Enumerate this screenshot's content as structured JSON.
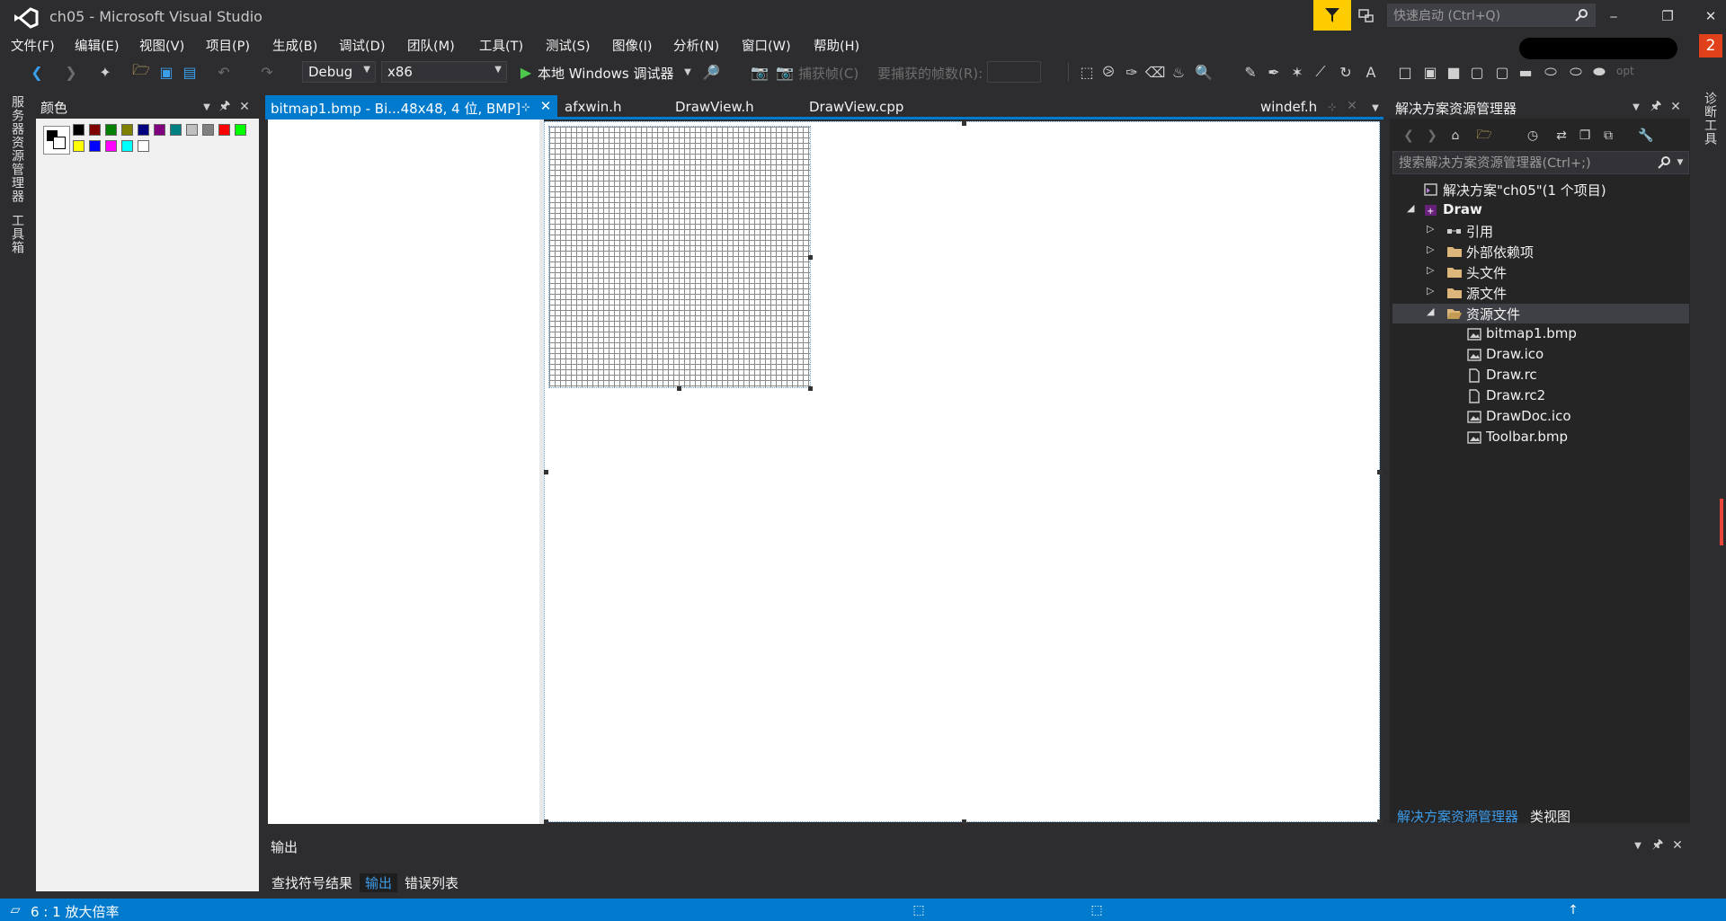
{
  "title_bar": {
    "title": "ch05 - Microsoft Visual Studio",
    "quick_launch_placeholder": "快速启动 (Ctrl+Q)",
    "notification_count": "2"
  },
  "menu": [
    "文件(F)",
    "编辑(E)",
    "视图(V)",
    "项目(P)",
    "生成(B)",
    "调试(D)",
    "团队(M)",
    "工具(T)",
    "测试(S)",
    "图像(I)",
    "分析(N)",
    "窗口(W)",
    "帮助(H)"
  ],
  "toolbar": {
    "config": "Debug",
    "platform": "x86",
    "run_label": "本地 Windows 调试器",
    "capture_label": "捕获帧(C)",
    "frames_label": "要捕获的帧数(R):",
    "opt_label": "opt"
  },
  "left_strip": {
    "tab1": "服务器资源管理器",
    "tab2": "工具箱"
  },
  "color_panel": {
    "title": "颜色",
    "swatches": [
      "#000000",
      "#800000",
      "#008000",
      "#808000",
      "#000080",
      "#800080",
      "#008080",
      "#c0c0c0",
      "#808080",
      "#ff0000",
      "#00ff00",
      "#ffff00",
      "#0000ff",
      "#ff00ff",
      "#00ffff",
      "#ffffff"
    ]
  },
  "editor_tabs": {
    "active": "bitmap1.bmp - Bi...48x48, 4 位, BMP]",
    "tabs": [
      "afxwin.h",
      "DrawView.h",
      "DrawView.cpp"
    ],
    "right_tab": "windef.h"
  },
  "solution_explorer": {
    "title": "解决方案资源管理器",
    "search_placeholder": "搜索解决方案资源管理器(Ctrl+;)",
    "tree": [
      {
        "label": "解决方案\"ch05\"(1 个项目)",
        "level": 0,
        "arrow": "",
        "icon": "solution-icon"
      },
      {
        "label": "Draw",
        "level": 0,
        "arrow": "◢",
        "icon": "project-icon"
      },
      {
        "label": "引用",
        "level": 1,
        "arrow": "▷",
        "icon": "references-icon"
      },
      {
        "label": "外部依赖项",
        "level": 1,
        "arrow": "▷",
        "icon": "folder-icon"
      },
      {
        "label": "头文件",
        "level": 1,
        "arrow": "▷",
        "icon": "folder-icon"
      },
      {
        "label": "源文件",
        "level": 1,
        "arrow": "▷",
        "icon": "folder-icon"
      },
      {
        "label": "资源文件",
        "level": 1,
        "arrow": "◢",
        "icon": "folder-open-icon"
      },
      {
        "label": "bitmap1.bmp",
        "level": 2,
        "arrow": "",
        "icon": "image-file-icon"
      },
      {
        "label": "Draw.ico",
        "level": 2,
        "arrow": "",
        "icon": "image-file-icon"
      },
      {
        "label": "Draw.rc",
        "level": 2,
        "arrow": "",
        "icon": "file-icon"
      },
      {
        "label": "Draw.rc2",
        "level": 2,
        "arrow": "",
        "icon": "file-icon"
      },
      {
        "label": "DrawDoc.ico",
        "level": 2,
        "arrow": "",
        "icon": "image-file-icon"
      },
      {
        "label": "Toolbar.bmp",
        "level": 2,
        "arrow": "",
        "icon": "image-file-icon"
      }
    ],
    "selected_index": 6,
    "bottom_tabs": [
      "解决方案资源管理器",
      "类视图"
    ]
  },
  "right_strip": {
    "tab": "诊断工具"
  },
  "output": {
    "title": "输出",
    "tabs": [
      "查找符号结果",
      "输出",
      "错误列表"
    ],
    "active_tab": 1
  },
  "status_bar": {
    "zoom": "6 : 1 放大倍率"
  },
  "colors": {
    "accent": "#007acc",
    "background": "#2d2d30",
    "panel": "#252526",
    "badge": "#e0401a"
  }
}
